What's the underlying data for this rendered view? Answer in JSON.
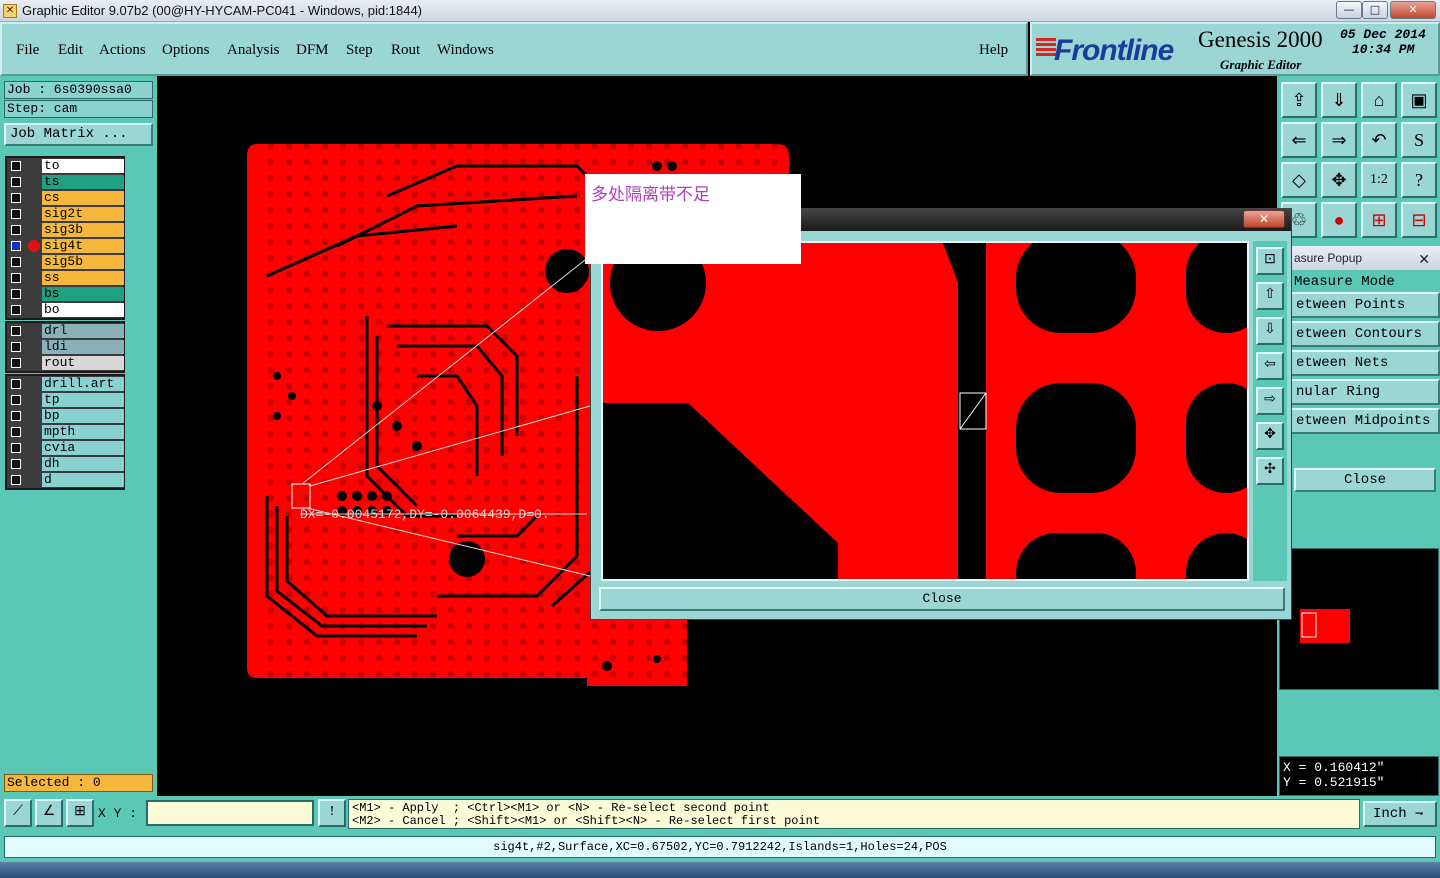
{
  "window": {
    "title": "Graphic Editor 9.07b2 (00@HY-HYCAM-PC041 - Windows, pid:1844)",
    "min": "—",
    "max": "□",
    "close": "✕"
  },
  "menu": {
    "items": [
      "File",
      "Edit",
      "Actions",
      "Options",
      "Analysis",
      "DFM",
      "Step",
      "Rout",
      "Windows"
    ],
    "help": "Help"
  },
  "brand": {
    "logo": "Frontline",
    "product": "Genesis 2000",
    "subtitle": "Graphic Editor",
    "date": "05 Dec 2014",
    "time": "10:34 PM"
  },
  "left": {
    "job": "Job : 6s0390ssa0",
    "step": "Step: cam",
    "job_matrix": "Job Matrix ...",
    "layers_board": [
      {
        "name": "to",
        "color": "#ffffff"
      },
      {
        "name": "ts",
        "color": "#20a080"
      },
      {
        "name": "cs",
        "color": "#f5b83c"
      },
      {
        "name": "sig2t",
        "color": "#f5b83c"
      },
      {
        "name": "sig3b",
        "color": "#f5b83c"
      },
      {
        "name": "sig4t",
        "color": "#f5b83c"
      },
      {
        "name": "sig5b",
        "color": "#f5b83c"
      },
      {
        "name": "ss",
        "color": "#f5b83c"
      },
      {
        "name": "bs",
        "color": "#20a080"
      },
      {
        "name": "bo",
        "color": "#ffffff"
      }
    ],
    "layers_drill": [
      {
        "name": "drl",
        "color": "#8ab0b8"
      },
      {
        "name": "ldi",
        "color": "#8ab0b8"
      },
      {
        "name": "rout",
        "color": "#d8d8d8"
      }
    ],
    "layers_misc": [
      {
        "name": "drill.art",
        "color": "#8ad2d0"
      },
      {
        "name": "tp",
        "color": "#8ad2d0"
      },
      {
        "name": "bp",
        "color": "#8ad2d0"
      },
      {
        "name": "mpth",
        "color": "#8ad2d0"
      },
      {
        "name": "cvia",
        "color": "#8ad2d0"
      },
      {
        "name": "dh",
        "color": "#8ad2d0"
      },
      {
        "name": "d",
        "color": "#8ad2d0"
      }
    ],
    "selected": "Selected : 0"
  },
  "canvas": {
    "measure_text": "DX=-0.0045172,DY=-0.0064439,D=0.",
    "annotation": "多处隔离带不足",
    "board_color": "#ff0000"
  },
  "zoom_popup": {
    "close_label": "Close",
    "x_label": "✕"
  },
  "measure_popup": {
    "title": "asure Popup",
    "mode": "Measure Mode",
    "options": [
      "etween Points",
      "etween Contours",
      "etween Nets",
      "nular Ring",
      "etween Midpoints"
    ],
    "close": "Close"
  },
  "coords": {
    "x": "X = 0.160412\"",
    "y": "Y = 0.521915\""
  },
  "bottom": {
    "xy_label": "X Y :",
    "hint_line1": "<M1> - Apply  ; <Ctrl><M1> or <N> - Re-select second point",
    "hint_line2": "<M2> - Cancel ; <Shift><M1> or <Shift><N> - Re-select first point",
    "units": "Inch"
  },
  "status": "sig4t,#2,Surface,XC=0.67502,YC=0.7912242,Islands=1,Holes=24,POS",
  "icons": [
    "app-icon",
    "minimize-icon",
    "maximize-icon",
    "close-icon",
    "pen-icon",
    "zoom-in-icon",
    "zoom-out-icon",
    "pan-icon",
    "fit-icon",
    "one-to-one-icon",
    "help-icon",
    "undo-icon",
    "measure-icon",
    "select-icon",
    "cross-icon",
    "exclaim-icon"
  ]
}
